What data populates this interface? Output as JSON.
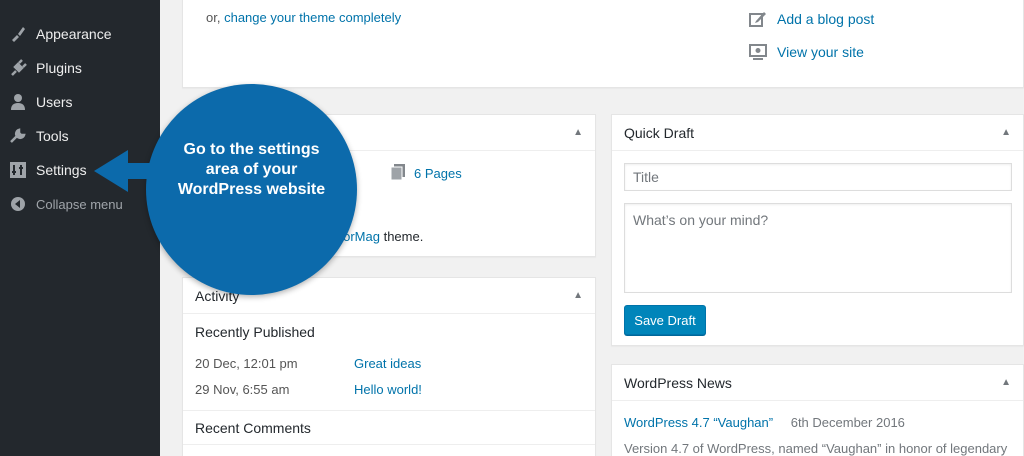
{
  "sidebar": {
    "items": [
      {
        "label": "Appearance",
        "icon": "paintbrush-icon"
      },
      {
        "label": "Plugins",
        "icon": "plugin-icon"
      },
      {
        "label": "Users",
        "icon": "user-icon"
      },
      {
        "label": "Tools",
        "icon": "wrench-icon"
      },
      {
        "label": "Settings",
        "icon": "settings-icon"
      },
      {
        "label": "Collapse menu",
        "icon": "collapse-icon"
      }
    ]
  },
  "welcome": {
    "or_text": "or,",
    "change_theme_link": "change your theme completely",
    "add_blog_post": "Add a blog post",
    "view_site": "View your site"
  },
  "glance": {
    "pages": "6 Pages",
    "theme_link_fragment": "olorMag",
    "theme_suffix": " theme."
  },
  "activity": {
    "title": "Activity",
    "recently_published": "Recently Published",
    "posts": [
      {
        "date": "20 Dec, 12:01 pm",
        "title": "Great ideas"
      },
      {
        "date": "29 Nov, 6:55 am",
        "title": "Hello world!"
      }
    ],
    "recent_comments": "Recent Comments"
  },
  "quick_draft": {
    "title": "Quick Draft",
    "title_placeholder": "Title",
    "content_placeholder": "What’s on your mind?",
    "save_button": "Save Draft"
  },
  "news": {
    "title": "WordPress News",
    "item_title": "WordPress 4.7 “Vaughan”",
    "item_date": "6th December 2016",
    "item_excerpt": "Version 4.7 of WordPress, named “Vaughan” in honor of legendary"
  },
  "callout": {
    "text": "Go to the settings area of your WordPress website"
  },
  "colors": {
    "sidebar_bg": "#23282d",
    "link": "#0073aa",
    "callout": "#0c6aab",
    "button": "#0085ba"
  }
}
